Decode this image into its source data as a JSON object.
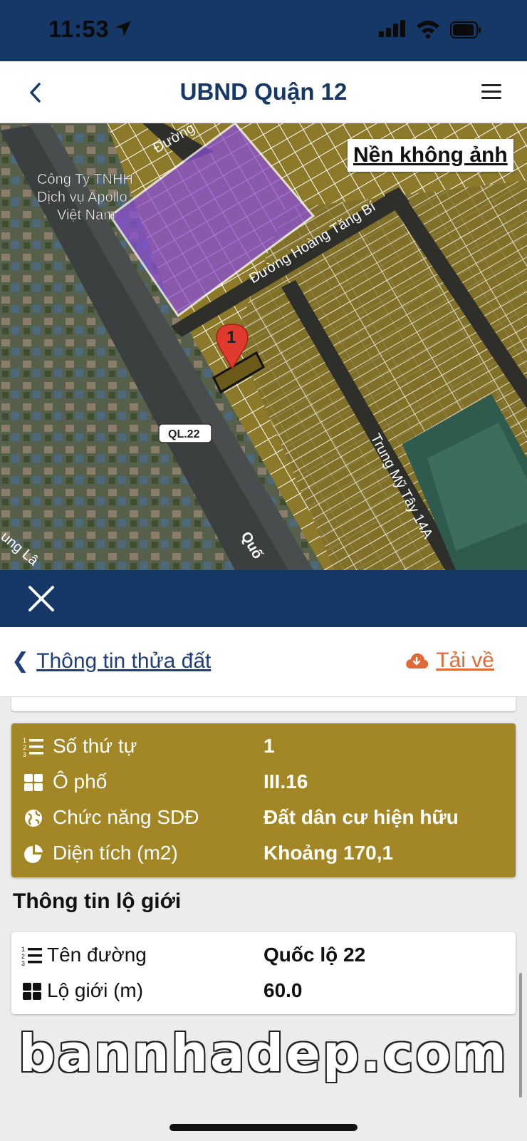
{
  "status": {
    "time": "11:53"
  },
  "header": {
    "title": "UBND Quận 12"
  },
  "map": {
    "toggle_label": "Nền không ảnh",
    "labels": {
      "company_line1": "Công Ty TNHH",
      "company_line2": "Dịch vụ Apollo",
      "company_line3": "Việt Nam",
      "street_top": "Đường",
      "street_hoang_tang_bi": "Đường Hoàng Tăng Bí",
      "street_trung_my_tay": "Trung Mỹ Tây 14A",
      "highway_badge": "QL.22",
      "pin_number": "1",
      "street_bottom_left": "ung Lâ",
      "street_bottom": "Quố"
    }
  },
  "panel": {
    "back_label": "Thông tin thửa đất",
    "download_label": "Tải về",
    "parcel": [
      {
        "icon": "ordered-list-icon",
        "label": "Số thứ tự",
        "value": "1"
      },
      {
        "icon": "grid-icon",
        "label": "Ô phố",
        "value": "III.16"
      },
      {
        "icon": "globe-icon",
        "label": "Chức năng SDĐ",
        "value": "Đất dân cư hiện hữu"
      },
      {
        "icon": "pie-chart-icon",
        "label": "Diện tích (m2)",
        "value": "Khoảng 170,1"
      }
    ],
    "road_section_title": "Thông tin lộ giới",
    "road": [
      {
        "icon": "ordered-list-icon",
        "label": "Tên đường",
        "value": "Quốc lộ 22"
      },
      {
        "icon": "grid-icon",
        "label": "Lộ giới (m)",
        "value": "60.0"
      }
    ]
  },
  "watermark": "bannhadep.com",
  "colors": {
    "navy": "#153866",
    "parcel_card": "#a38726",
    "download": "#e06a35",
    "land_overlay": "#8c7a2a",
    "highlight_purple": "#8a4fd6",
    "pin_red": "#e03a2f"
  }
}
